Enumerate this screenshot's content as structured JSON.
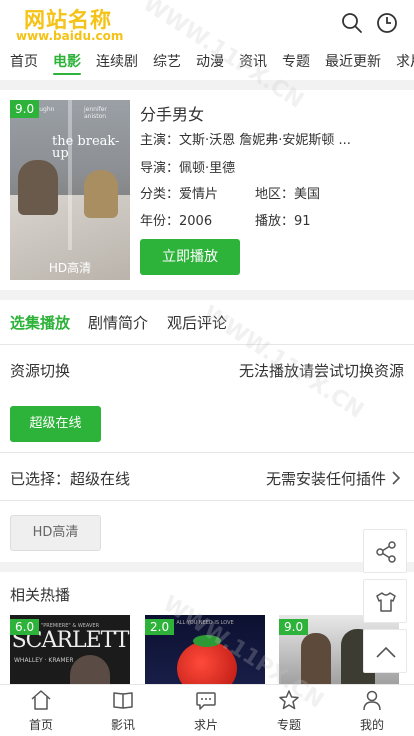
{
  "logo": {
    "name": "网站名称",
    "url": "www.baidu.com"
  },
  "nav": [
    "首页",
    "电影",
    "连续剧",
    "综艺",
    "动漫",
    "资讯",
    "专题",
    "最近更新",
    "求片"
  ],
  "movie": {
    "score": "9.0",
    "title": "分手男女",
    "poster_hd": "HD高清",
    "poster_title": "the break-up",
    "poster_names": [
      "vaughn",
      "jennifer aniston"
    ],
    "cast_label": "主演：",
    "cast": "文斯·沃恩 詹妮弗·安妮斯顿 ...",
    "director_label": "导演：",
    "director": "佩顿·里德",
    "category_label": "分类：",
    "category": "爱情片",
    "region_label": "地区：",
    "region": "美国",
    "year_label": "年份：",
    "year": "2006",
    "plays_label": "播放：",
    "plays": "91",
    "play_button": "立即播放"
  },
  "tabs": [
    "选集播放",
    "剧情简介",
    "观后评论"
  ],
  "source": {
    "switch_label": "资源切换",
    "switch_hint": "无法播放请尝试切换资源",
    "source_button": "超级在线",
    "selected_label": "已选择：超级在线",
    "plugin_hint": "无需安装任何插件",
    "quality_button": "HD高清"
  },
  "related": {
    "title": "相关热播",
    "items": [
      {
        "score": "6.0",
        "caption_top": "\"PREMIERE\" & WEAVER",
        "title": "SCARLETT",
        "caption_bottom": "WHALLEY · KRAMER"
      },
      {
        "score": "2.0",
        "caption_top": "ALL YOU NEED IS LOVE"
      },
      {
        "score": "9.0"
      }
    ]
  },
  "bottom_nav": [
    "首页",
    "影讯",
    "求片",
    "专题",
    "我的"
  ],
  "watermark": "WWW.11PX.CN",
  "colors": {
    "accent": "#2db23a",
    "logo": "#f5c216"
  }
}
